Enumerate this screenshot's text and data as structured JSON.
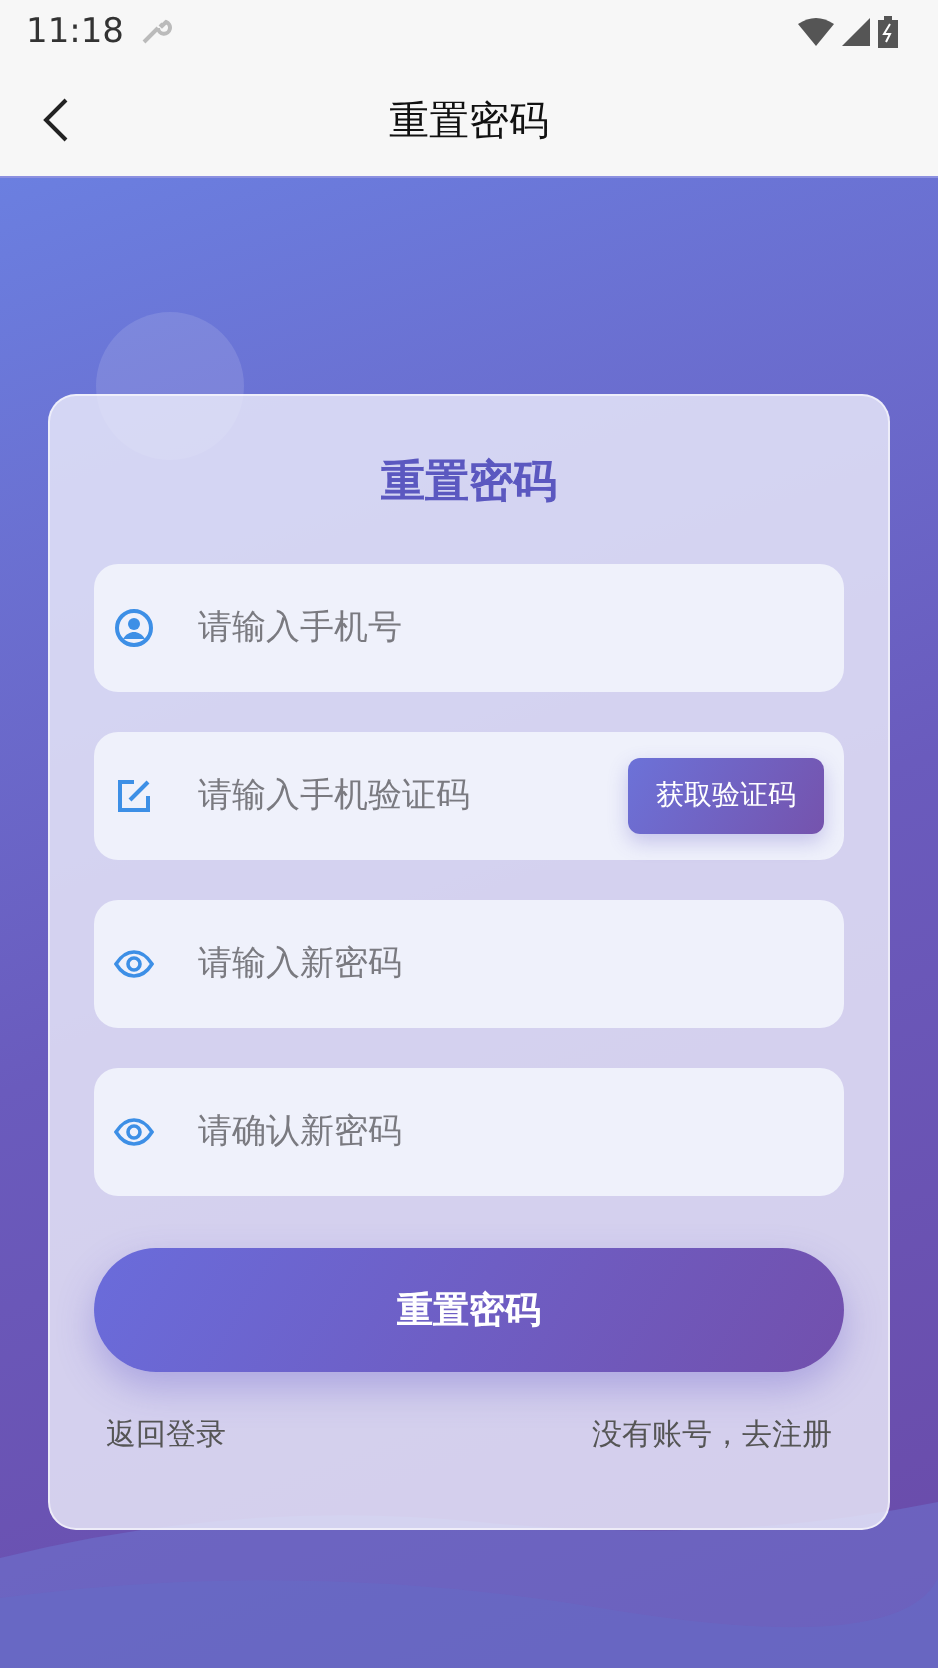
{
  "status_bar": {
    "time": "11:18"
  },
  "app_bar": {
    "title": "重置密码"
  },
  "form": {
    "title": "重置密码",
    "fields": [
      {
        "kind": "phone",
        "placeholder": "请输入手机号"
      },
      {
        "kind": "code",
        "placeholder": "请输入手机验证码",
        "button": "获取验证码"
      },
      {
        "kind": "password",
        "placeholder": "请输入新密码"
      },
      {
        "kind": "password",
        "placeholder": "请确认新密码"
      }
    ],
    "submit": "重置密码",
    "links": [
      "返回登录",
      "没有账号，去注册"
    ]
  }
}
